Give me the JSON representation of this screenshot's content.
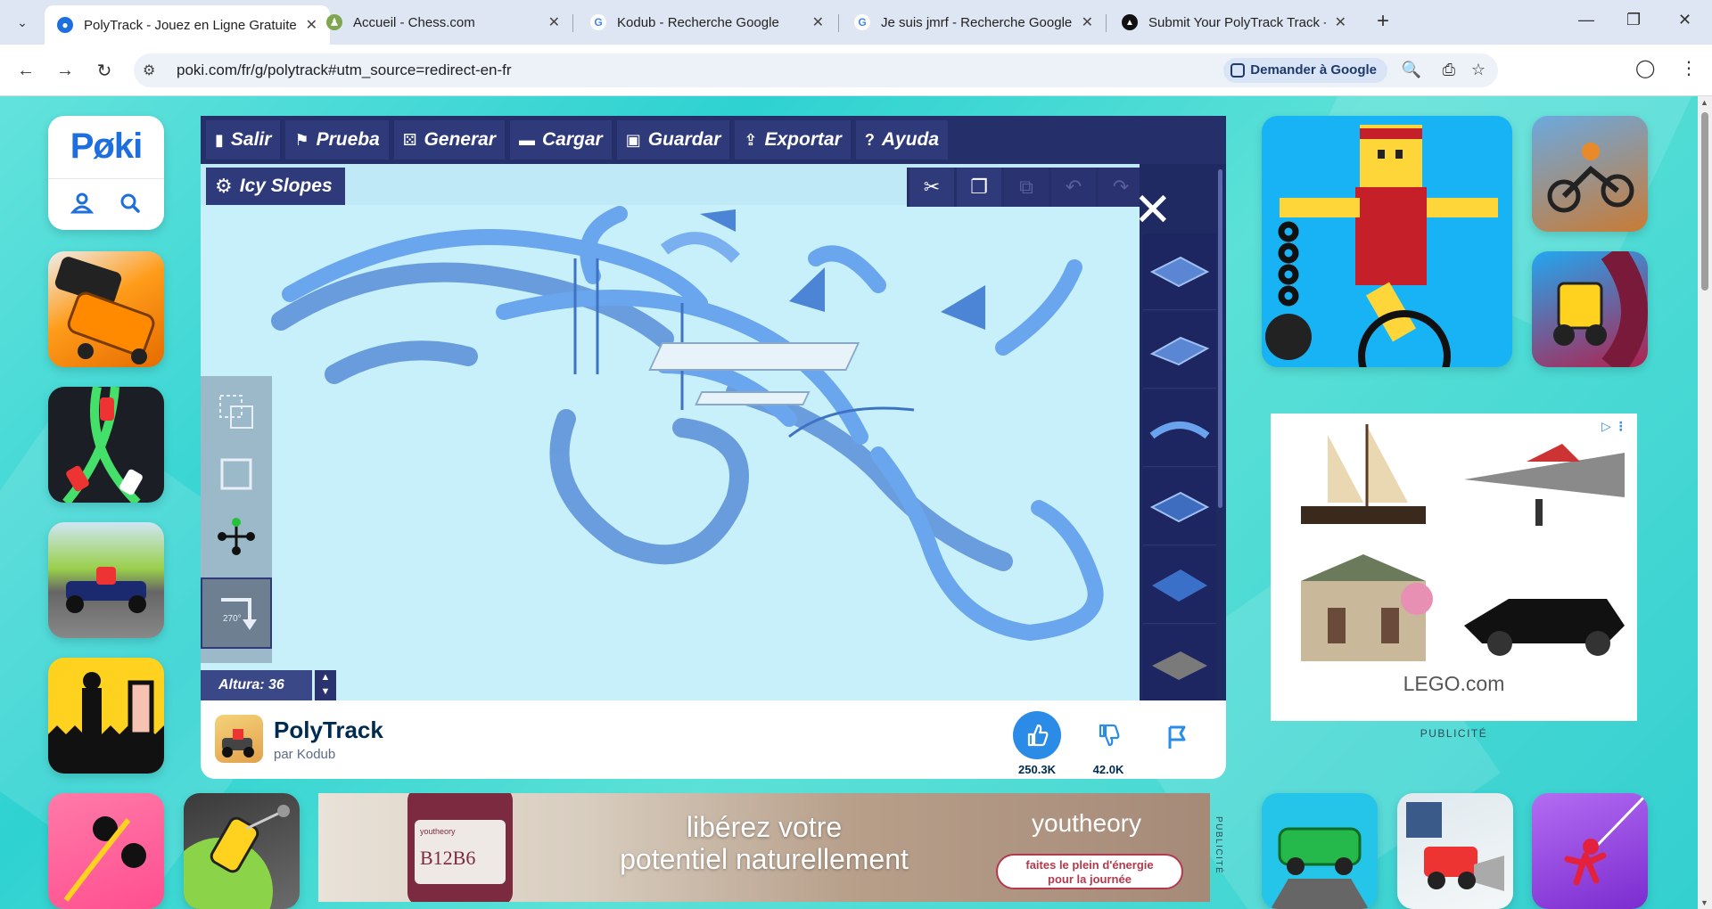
{
  "browser": {
    "tabs": [
      {
        "title": "PolyTrack - Jouez en Ligne Gratuitement",
        "close": "✕",
        "active": true
      },
      {
        "title": "Accueil - Chess.com",
        "close": "✕",
        "active": false
      },
      {
        "title": "Kodub - Recherche Google",
        "close": "✕",
        "active": false
      },
      {
        "title": "Je suis jmrf - Recherche Google",
        "close": "✕",
        "active": false
      },
      {
        "title": "Submit Your PolyTrack Track - Submit",
        "close": "✕",
        "active": false
      }
    ],
    "new_tab": "+",
    "url": "poki.com/fr/g/polytrack#utm_source=redirect-en-fr",
    "ask_google": "Demander à Google",
    "window": {
      "minimize": "—",
      "restore": "❐",
      "close": "✕"
    }
  },
  "poki": {
    "logo": "Pøki"
  },
  "editor": {
    "menu": [
      {
        "label": "Salir",
        "icon": "exit-icon",
        "glyph": "▮"
      },
      {
        "label": "Prueba",
        "icon": "flag-icon",
        "glyph": "⚑"
      },
      {
        "label": "Generar",
        "icon": "dice-icon",
        "glyph": "⚄"
      },
      {
        "label": "Cargar",
        "icon": "folder-icon",
        "glyph": "▬"
      },
      {
        "label": "Guardar",
        "icon": "save-icon",
        "glyph": "▣"
      },
      {
        "label": "Exportar",
        "icon": "export-icon",
        "glyph": "⇪"
      },
      {
        "label": "Ayuda",
        "icon": "help-icon",
        "glyph": "?"
      }
    ],
    "track_name": "Icy Slopes",
    "track_icon": "⚙",
    "tools": {
      "cut": "✂",
      "copy": "❐",
      "paste": "⧉",
      "undo": "↶",
      "redo": "↷"
    },
    "close": "✕",
    "altura": "Altura: 36",
    "rotation": "270°"
  },
  "game": {
    "title": "PolyTrack",
    "author": "par Kodub",
    "likes": "250.3K",
    "dislikes": "42.0K"
  },
  "ads": {
    "lego_label": "LEGO.com",
    "lego_pub": "PUBLICITÉ",
    "banner_headline_1": "libérez votre",
    "banner_headline_2": "potentiel naturellement",
    "banner_brand": "youtheory",
    "banner_cta_1": "faites le plein d'énergie",
    "banner_cta_2": "pour la journée",
    "banner_jar_text": "B12B6",
    "banner_jar_brand": "youtheory",
    "banner_pub": "PUBLICITÉ"
  }
}
